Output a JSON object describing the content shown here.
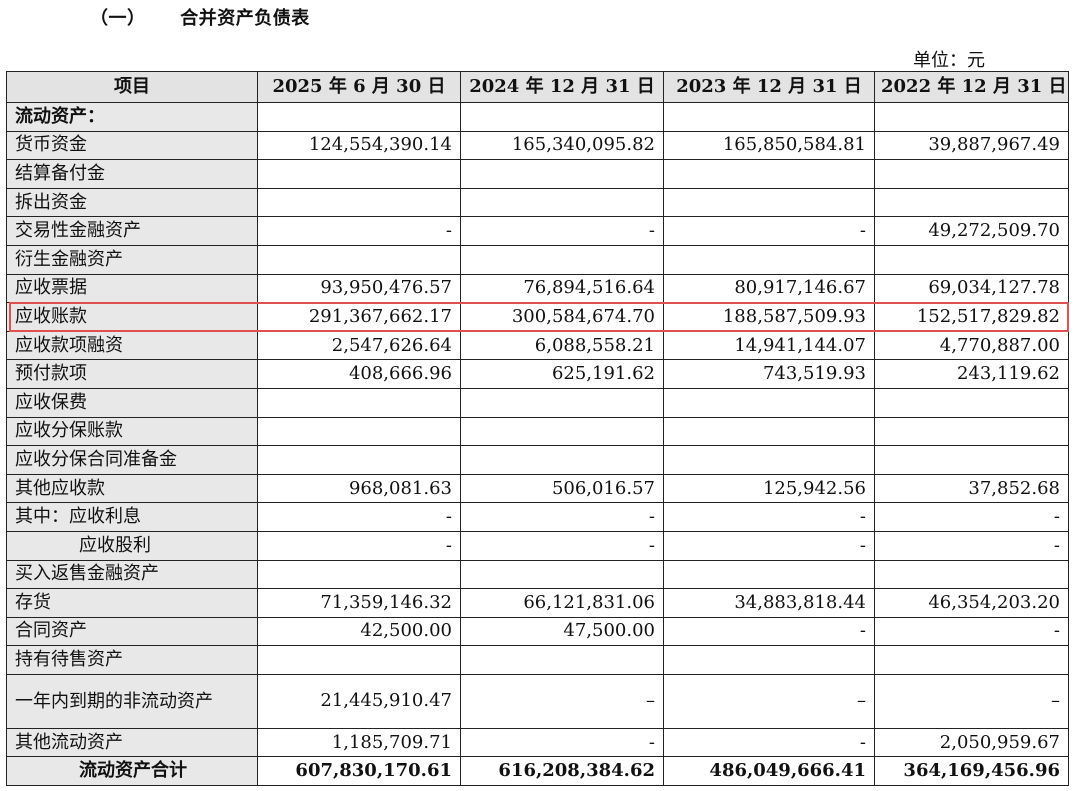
{
  "heading": {
    "section": "（一）",
    "title": "合并资产负债表"
  },
  "unit_label": "单位：元",
  "table": {
    "headers": [
      "项目",
      "2025 年 6 月 30 日",
      "2024 年 12 月 31 日",
      "2023 年 12 月 31 日",
      "2022 年 12 月 31 日"
    ],
    "rows": [
      {
        "label": "流动资产：",
        "values": [
          "",
          "",
          "",
          ""
        ],
        "kind": "section"
      },
      {
        "label": "货币资金",
        "values": [
          "124,554,390.14",
          "165,340,095.82",
          "165,850,584.81",
          "39,887,967.49"
        ]
      },
      {
        "label": "结算备付金",
        "values": [
          "",
          "",
          "",
          ""
        ]
      },
      {
        "label": "拆出资金",
        "values": [
          "",
          "",
          "",
          ""
        ]
      },
      {
        "label": "交易性金融资产",
        "values": [
          "-",
          "-",
          "-",
          "49,272,509.70"
        ]
      },
      {
        "label": "衍生金融资产",
        "values": [
          "",
          "",
          "",
          ""
        ]
      },
      {
        "label": "应收票据",
        "values": [
          "93,950,476.57",
          "76,894,516.64",
          "80,917,146.67",
          "69,034,127.78"
        ]
      },
      {
        "label": "应收账款",
        "values": [
          "291,367,662.17",
          "300,584,674.70",
          "188,587,509.93",
          "152,517,829.82"
        ],
        "highlighted": true
      },
      {
        "label": "应收款项融资",
        "values": [
          "2,547,626.64",
          "6,088,558.21",
          "14,941,144.07",
          "4,770,887.00"
        ]
      },
      {
        "label": "预付款项",
        "values": [
          "408,666.96",
          "625,191.62",
          "743,519.93",
          "243,119.62"
        ]
      },
      {
        "label": "应收保费",
        "values": [
          "",
          "",
          "",
          ""
        ]
      },
      {
        "label": "应收分保账款",
        "values": [
          "",
          "",
          "",
          ""
        ]
      },
      {
        "label": "应收分保合同准备金",
        "values": [
          "",
          "",
          "",
          ""
        ]
      },
      {
        "label": "其他应收款",
        "values": [
          "968,081.63",
          "506,016.57",
          "125,942.56",
          "37,852.68"
        ]
      },
      {
        "label": "其中：应收利息",
        "values": [
          "-",
          "-",
          "-",
          "-"
        ]
      },
      {
        "label": "应收股利",
        "values": [
          "-",
          "-",
          "-",
          "-"
        ],
        "kind": "indent"
      },
      {
        "label": "买入返售金融资产",
        "values": [
          "",
          "",
          "",
          ""
        ]
      },
      {
        "label": "存货",
        "values": [
          "71,359,146.32",
          "66,121,831.06",
          "34,883,818.44",
          "46,354,203.20"
        ]
      },
      {
        "label": "合同资产",
        "values": [
          "42,500.00",
          "47,500.00",
          "-",
          "-"
        ]
      },
      {
        "label": "持有待售资产",
        "values": [
          "",
          "",
          "",
          ""
        ]
      },
      {
        "label": "一年内到期的非流动资产",
        "values": [
          "21,445,910.47",
          "–",
          "–",
          "–"
        ],
        "kind": "tall"
      },
      {
        "label": "其他流动资产",
        "values": [
          "1,185,709.71",
          "-",
          "-",
          "2,050,959.67"
        ]
      },
      {
        "label": "流动资产合计",
        "values": [
          "607,830,170.61",
          "616,208,384.62",
          "486,049,666.41",
          "364,169,456.96"
        ],
        "kind": "total"
      }
    ]
  }
}
